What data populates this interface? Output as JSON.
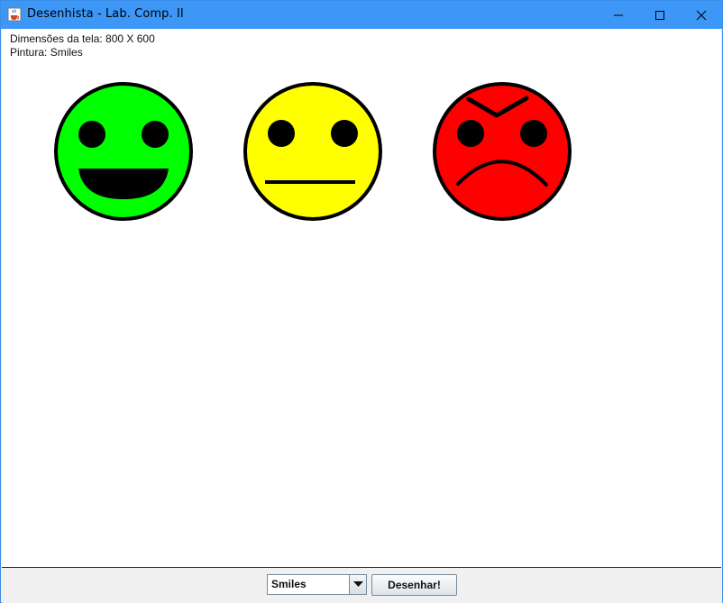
{
  "window": {
    "title": "Desenhista - Lab. Comp. II",
    "icon": "java-coffee-icon",
    "controls": [
      "minimize-icon",
      "maximize-icon",
      "close-icon"
    ],
    "titlebar_color": "#3d97f7"
  },
  "canvas": {
    "dimensions_text": "Dimensões da tela: 800 X 600",
    "painting_text": "Pintura: Smiles",
    "background": "#ffffff",
    "smiles": [
      {
        "mood": "happy",
        "color": "#00ff00"
      },
      {
        "mood": "neutral",
        "color": "#ffff00"
      },
      {
        "mood": "angry",
        "color": "#ff0000"
      }
    ]
  },
  "toolbar": {
    "select_value": "Smiles",
    "draw_label": "Desenhar!"
  }
}
